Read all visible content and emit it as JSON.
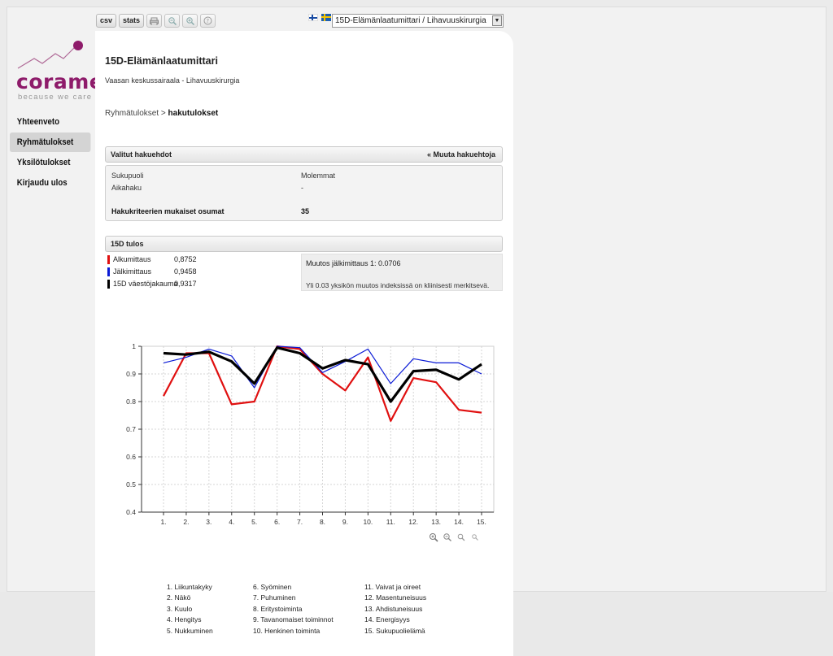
{
  "app": {
    "logo_word": "corame",
    "logo_tagline": "because we care"
  },
  "nav": {
    "items": [
      {
        "label": "Yhteenveto"
      },
      {
        "label": "Ryhmätulokset",
        "active": true
      },
      {
        "label": "Yksilötulokset"
      },
      {
        "label": "Kirjaudu ulos"
      }
    ]
  },
  "toolbar": {
    "csv_label": "csv",
    "stats_label": "stats",
    "icons": [
      "print-icon",
      "zoom-out-icon",
      "zoom-in-icon",
      "help-icon"
    ]
  },
  "language": {
    "flags": [
      "finland-flag-icon",
      "sweden-flag-icon"
    ],
    "selected_survey": "15D-Elämänlaatumittari / Lihavuuskirurgia"
  },
  "page": {
    "title": "15D-Elämänlaatumittari",
    "subtitle": "Vaasan keskussairaala - Lihavuuskirurgia",
    "breadcrumb_parent": "Ryhmätulokset",
    "breadcrumb_separator": " > ",
    "breadcrumb_current": "hakutulokset"
  },
  "criteria": {
    "header": "Valitut hakuehdot",
    "change_link": "« Muuta hakuehtoja",
    "rows": [
      {
        "label": "Sukupuoli",
        "value": "Molemmat"
      },
      {
        "label": "Aikahaku",
        "value": "-"
      }
    ],
    "matches_label": "Hakukriteerien mukaiset osumat",
    "matches_value": "35"
  },
  "result": {
    "header": "15D tulos",
    "legend": [
      {
        "label": "Alkumittaus",
        "value": "0,8752",
        "color": "#e01010"
      },
      {
        "label": "Jälkimittaus",
        "value": "0,9458",
        "color": "#0a1ad6"
      },
      {
        "label": "15D väestöjakauma",
        "value": "0,9317",
        "color": "#000000"
      }
    ],
    "change_text": "Muutos jälkimittaus 1: 0.0706",
    "note_text": "Yli 0.03 yksikön muutos indeksissä on kliinisesti merkitsevä."
  },
  "chart_data": {
    "type": "line",
    "x": [
      "1.",
      "2.",
      "3.",
      "4.",
      "5.",
      "6.",
      "7.",
      "8.",
      "9.",
      "10.",
      "11.",
      "12.",
      "13.",
      "14.",
      "15."
    ],
    "ylim": [
      0.4,
      1
    ],
    "yticks": [
      "0.4",
      "0.5",
      "0.6",
      "0.7",
      "0.8",
      "0.9",
      "1"
    ],
    "grid": true,
    "series": [
      {
        "name": "Alkumittaus",
        "color": "#e01010",
        "width": 2.2,
        "values": [
          0.82,
          0.975,
          0.975,
          0.79,
          0.8,
          1.0,
          0.99,
          0.9,
          0.84,
          0.96,
          0.73,
          0.885,
          0.87,
          0.77,
          0.76
        ]
      },
      {
        "name": "Jälkimittaus",
        "color": "#0a1ad6",
        "width": 1.2,
        "values": [
          0.94,
          0.96,
          0.99,
          0.965,
          0.85,
          1.0,
          0.995,
          0.905,
          0.945,
          0.99,
          0.865,
          0.955,
          0.94,
          0.94,
          0.9
        ]
      },
      {
        "name": "15D väestöjakauma",
        "color": "#000000",
        "width": 3.2,
        "values": [
          0.975,
          0.97,
          0.98,
          0.945,
          0.865,
          0.995,
          0.975,
          0.92,
          0.95,
          0.935,
          0.8,
          0.91,
          0.915,
          0.88,
          0.935
        ]
      }
    ]
  },
  "zoom_icons": [
    "zoom-in-large-icon",
    "zoom-in-icon",
    "zoom-out-icon",
    "zoom-out-small-icon"
  ],
  "dimensions": {
    "col1": [
      "1. Liikuntakyky",
      "2. Näkö",
      "3. Kuulo",
      "4. Hengitys",
      "5. Nukkuminen"
    ],
    "col2": [
      "6. Syöminen",
      "7. Puhuminen",
      "8. Eritystoiminta",
      "9. Tavanomaiset toiminnot",
      "10. Henkinen toiminta"
    ],
    "col3": [
      "11. Vaivat ja oireet",
      "12. Masentuneisuus",
      "13. Ahdistuneisuus",
      "14. Energisyys",
      "15. Sukupuolielämä"
    ]
  }
}
